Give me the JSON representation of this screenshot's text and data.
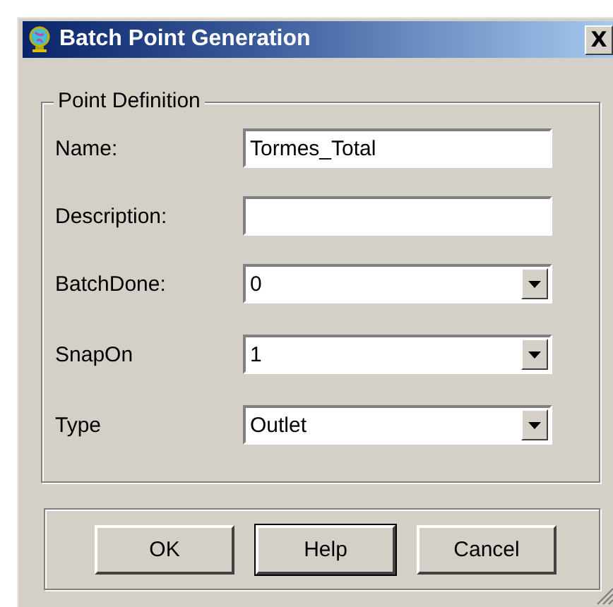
{
  "window": {
    "title": "Batch Point Generation",
    "close": "X"
  },
  "group": {
    "title": "Point Definition",
    "fields": [
      {
        "label": "Name:",
        "kind": "text",
        "value": "Tormes_Total"
      },
      {
        "label": "Description:",
        "kind": "text"
      },
      {
        "label": "BatchDone:",
        "kind": "combo",
        "value": "0"
      },
      {
        "label": "SnapOn",
        "kind": "combo",
        "value": "1"
      },
      {
        "label": "Type",
        "kind": "combo",
        "value": "Outlet"
      }
    ]
  },
  "buttons": [
    {
      "label": "OK",
      "default": false
    },
    {
      "label": "Help",
      "default": true
    },
    {
      "label": "Cancel",
      "default": false
    }
  ]
}
